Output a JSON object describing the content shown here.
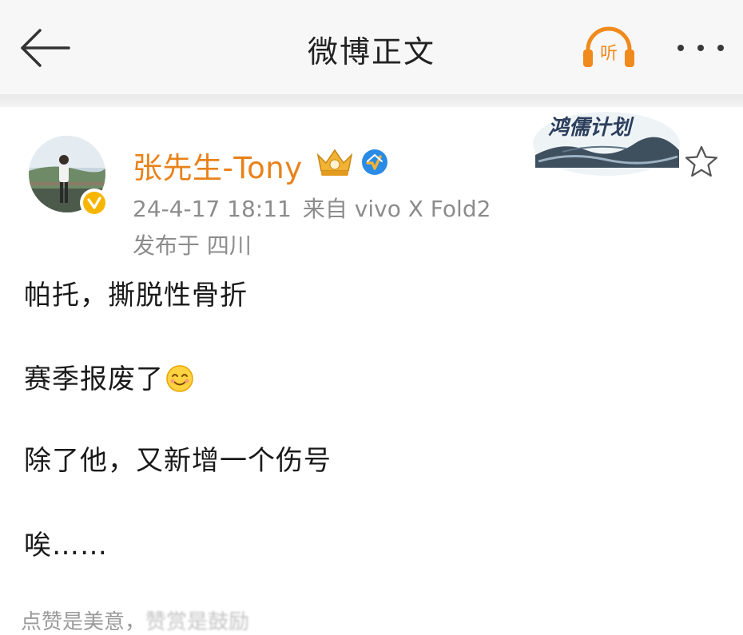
{
  "header": {
    "title": "微博正文",
    "listen_label": "听"
  },
  "post": {
    "username": "张先生-Tony",
    "timestamp": "24-4-17 18:11",
    "source": "来自 vivo X Fold2",
    "location": "发布于 四川",
    "banner_text": "鸿儒计划",
    "lines": [
      "帕托，撕脱性骨折",
      "赛季报废了",
      "除了他，又新增一个伤号",
      "唉……"
    ]
  },
  "footer": {
    "text_visible": "点赞是美意，",
    "text_blurred": "赞赏是鼓励"
  },
  "colors": {
    "username": "#e8821a",
    "meta": "#8c8c8c",
    "accent_orange": "#f08a1c",
    "verify_blue": "#2a8be6"
  },
  "icons": [
    "back-arrow-icon",
    "headphones-icon",
    "more-icon",
    "crown-icon",
    "blue-v-icon",
    "verified-badge-icon",
    "star-icon",
    "smile-emoji-icon"
  ]
}
